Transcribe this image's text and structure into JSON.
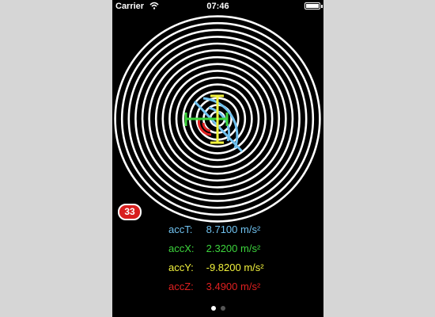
{
  "status_bar": {
    "carrier": "Carrier",
    "time": "07:46"
  },
  "badge": {
    "count": "33"
  },
  "readouts": [
    {
      "label": "accT:",
      "value": "8.7100 m/s²",
      "color": "#70c2f0"
    },
    {
      "label": "accX:",
      "value": "2.3200 m/s²",
      "color": "#3cd43c"
    },
    {
      "label": "accY:",
      "value": "-9.8200 m/s²",
      "color": "#f2f23c"
    },
    {
      "label": "accZ:",
      "value": "3.4900 m/s²",
      "color": "#e02020"
    }
  ],
  "page_control": {
    "pages": 2,
    "current": 1
  },
  "colors": {
    "background": "#000000",
    "rings": "#ffffff",
    "accT": "#70c2f0",
    "accX": "#3cd43c",
    "accY": "#f2f23c",
    "accZ": "#e02020"
  },
  "icons": [
    "wifi-icon",
    "battery-icon"
  ]
}
